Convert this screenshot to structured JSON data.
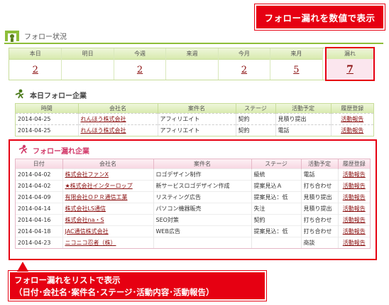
{
  "callouts": {
    "top": "フォロー漏れを数値で表示",
    "bottom_line1": "フォロー漏れをリストで表示",
    "bottom_line2": "（日付･会社名･案件名･ステージ･活動内容･活動報告）"
  },
  "status": {
    "title": "フォロー状況",
    "columns": [
      {
        "label": "本日",
        "value": "2"
      },
      {
        "label": "明日",
        "value": ""
      },
      {
        "label": "今週",
        "value": "2"
      },
      {
        "label": "来週",
        "value": ""
      },
      {
        "label": "今月",
        "value": "2"
      },
      {
        "label": "来月",
        "value": "5"
      },
      {
        "label": "漏れ",
        "value": "7"
      }
    ]
  },
  "today": {
    "title": "本日フォロー企業",
    "headers": [
      "時間",
      "会社名",
      "案件名",
      "ステージ",
      "活動予定",
      "履歴登録"
    ],
    "rows": [
      {
        "time": "2014-04-25",
        "company": "れんほう株式会社",
        "project": "アフィリエイト",
        "stage": "契約",
        "plan": "見積り提出",
        "action": "活動報告"
      },
      {
        "time": "2014-04-25",
        "company": "れんほう株式会社",
        "project": "アフィリエイト",
        "stage": "契約",
        "plan": "電話",
        "action": "活動報告"
      }
    ]
  },
  "missed": {
    "title": "フォロー漏れ企業",
    "headers": [
      "日付",
      "会社名",
      "案件名",
      "ステージ",
      "活動予定",
      "履歴登録"
    ],
    "rows": [
      {
        "date": "2014-04-02",
        "company": "株式会社ファンX",
        "project": "ロゴデザイン制作",
        "stage": "級統",
        "plan": "電話",
        "action": "活動報告"
      },
      {
        "date": "2014-04-02",
        "company": "★株式会社インターロップ",
        "project": "新サービスロゴデザイン作成",
        "stage": "提案見込Ａ",
        "plan": "打ち合わせ",
        "action": "活動報告"
      },
      {
        "date": "2014-04-09",
        "company": "有限会社ＯＰＲ通信工業",
        "project": "リスティング広告",
        "stage": "提案見込：低",
        "plan": "見積り提出",
        "action": "活動報告"
      },
      {
        "date": "2014-04-14",
        "company": "株式会社LS通信",
        "project": "パソコン機器販売",
        "stage": "失注",
        "plan": "見積り提出",
        "action": "活動報告"
      },
      {
        "date": "2014-04-16",
        "company": "株式会社na・S",
        "project": "SEO対策",
        "stage": "契約",
        "plan": "打ち合わせ",
        "action": "活動報告"
      },
      {
        "date": "2014-04-18",
        "company": "JAC通信株式会社",
        "project": "WEB広告",
        "stage": "提案見込：低",
        "plan": "打ち合わせ",
        "action": "活動報告"
      },
      {
        "date": "2014-04-23",
        "company": "ニコニコ忍者（株）",
        "project": "",
        "stage": "",
        "plan": "商談",
        "action": "活動報告"
      }
    ]
  }
}
